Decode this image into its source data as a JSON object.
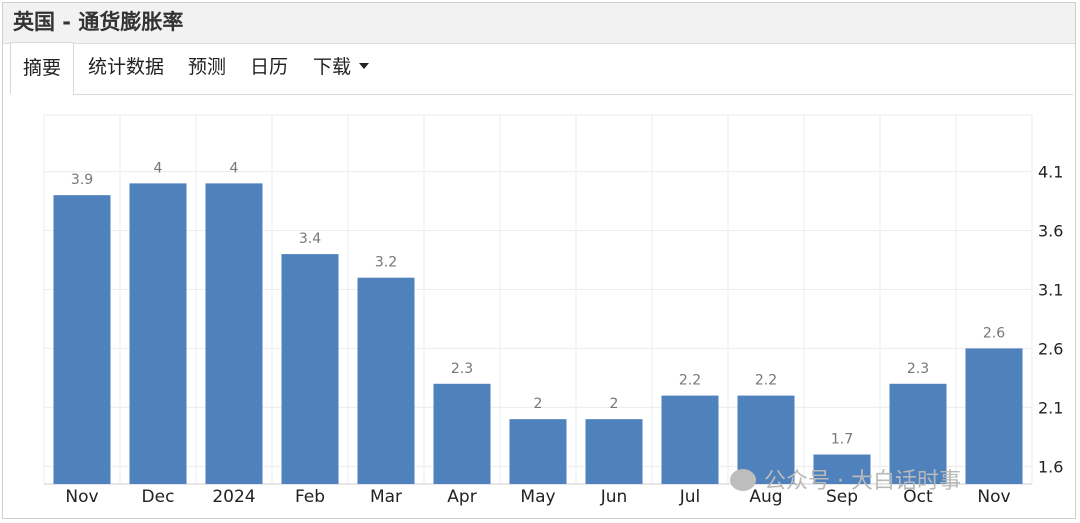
{
  "page": {
    "title": "英国 - 通货膨胀率"
  },
  "tabs": [
    {
      "label": "摘要",
      "active": true
    },
    {
      "label": "统计数据"
    },
    {
      "label": "预测"
    },
    {
      "label": "日历"
    },
    {
      "label": "下载",
      "has_dropdown": true
    }
  ],
  "watermark": "公众号 · 大白话时事",
  "chart_data": {
    "type": "bar",
    "categories": [
      "Nov",
      "Dec",
      "2024",
      "Feb",
      "Mar",
      "Apr",
      "May",
      "Jun",
      "Jul",
      "Aug",
      "Sep",
      "Oct",
      "Nov"
    ],
    "values": [
      3.9,
      4,
      4,
      3.4,
      3.2,
      2.3,
      2,
      2,
      2.2,
      2.2,
      1.7,
      2.3,
      2.6
    ],
    "data_labels": [
      "3.9",
      "4",
      "4",
      "3.4",
      "3.2",
      "2.3",
      "2",
      "2",
      "2.2",
      "2.2",
      "1.7",
      "2.3",
      "2.6"
    ],
    "y_axis_side": "right",
    "yticks": [
      1.6,
      2.1,
      2.6,
      3.1,
      3.6,
      4.1
    ],
    "ytick_labels": [
      "1.6",
      "2.1",
      "2.6",
      "3.1",
      "3.6",
      "4.1"
    ],
    "ylim": [
      1.45,
      4.58
    ],
    "grid": true,
    "bar_color": "#4f81bd",
    "grid_color": "#ececec"
  }
}
